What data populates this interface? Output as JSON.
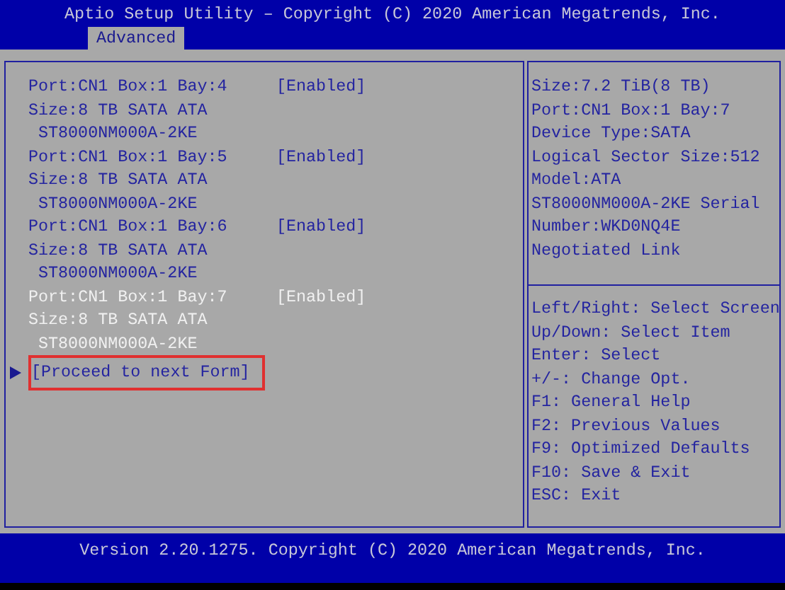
{
  "title": "Aptio Setup Utility – Copyright (C) 2020 American Megatrends, Inc.",
  "tabs": [
    {
      "label": "Advanced",
      "selected": true
    }
  ],
  "drives": [
    {
      "port": "Port:CN1 Box:1 Bay:4",
      "value": "[Enabled]",
      "size": "Size:8 TB SATA ATA",
      "model": "ST8000NM000A-2KE",
      "selected": false
    },
    {
      "port": "Port:CN1 Box:1 Bay:5",
      "value": "[Enabled]",
      "size": "Size:8 TB SATA ATA",
      "model": "ST8000NM000A-2KE",
      "selected": false
    },
    {
      "port": "Port:CN1 Box:1 Bay:6",
      "value": "[Enabled]",
      "size": "Size:8 TB SATA ATA",
      "model": "ST8000NM000A-2KE",
      "selected": false
    },
    {
      "port": "Port:CN1 Box:1 Bay:7",
      "value": "[Enabled]",
      "size": "Size:8 TB SATA ATA",
      "model": "ST8000NM000A-2KE",
      "selected": true
    }
  ],
  "link": {
    "label": "[Proceed to next Form]",
    "highlighted": true
  },
  "help": [
    "Size:7.2 TiB(8 TB)",
    "Port:CN1 Box:1 Bay:7",
    "Device Type:SATA",
    "Logical Sector Size:512",
    "Model:ATA",
    "ST8000NM000A-2KE Serial",
    "Number:WKD0NQ4E",
    "Negotiated Link"
  ],
  "keys": [
    "Left/Right: Select Screen",
    "Up/Down: Select Item",
    "Enter: Select",
    "+/-: Change Opt.",
    "F1: General Help",
    "F2: Previous Values",
    "F9: Optimized Defaults",
    "F10: Save & Exit",
    "ESC: Exit"
  ],
  "footer": "Version 2.20.1275. Copyright (C) 2020 American Megatrends, Inc."
}
